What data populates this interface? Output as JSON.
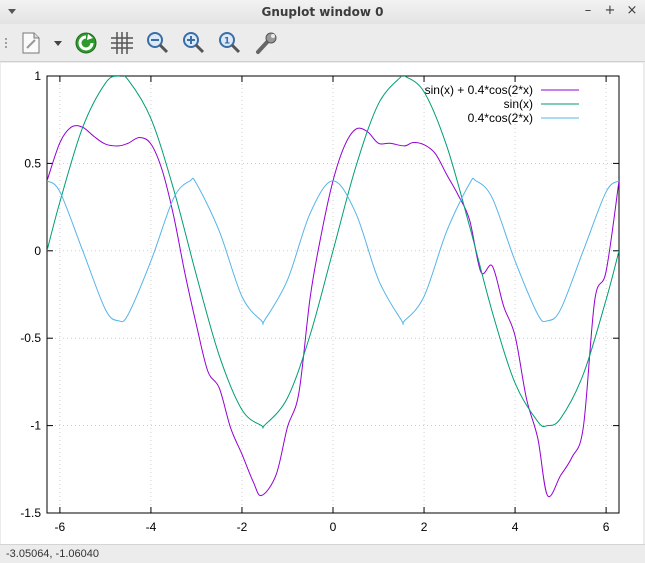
{
  "window": {
    "title": "Gnuplot window 0",
    "controls": [
      "–",
      "+",
      "×"
    ]
  },
  "toolbar": {
    "items": [
      {
        "name": "export-icon",
        "tooltip": ""
      },
      {
        "name": "replot-icon",
        "tooltip": ""
      },
      {
        "name": "grid-icon",
        "tooltip": ""
      },
      {
        "name": "zoom-out-icon",
        "tooltip": ""
      },
      {
        "name": "zoom-in-icon",
        "tooltip": ""
      },
      {
        "name": "zoom-reset-icon",
        "tooltip": ""
      },
      {
        "name": "settings-wrench-icon",
        "tooltip": ""
      }
    ]
  },
  "status": {
    "coords": "-3.05064, -1.06040"
  },
  "chart_data": {
    "type": "line",
    "title": "",
    "xlabel": "",
    "ylabel": "",
    "xlim": [
      -6.2832,
      6.2832
    ],
    "ylim": [
      -1.5,
      1
    ],
    "xticks": [
      -6,
      -4,
      -2,
      0,
      2,
      4,
      6
    ],
    "xtick_labels": [
      "-6",
      "-4",
      "-2",
      "0",
      "2",
      "4",
      "6"
    ],
    "yticks": [
      -1.5,
      -1,
      -0.5,
      0,
      0.5,
      1
    ],
    "ytick_labels": [
      "-1.5",
      "-1",
      "-0.5",
      "0",
      "0.5",
      "1"
    ],
    "grid": true,
    "legend_position": "top-right",
    "series": [
      {
        "name": "sin(x) + 0.4*cos(2*x)",
        "color": "#9400d3",
        "x": [
          -6.2832,
          -6,
          -5.75,
          -5.5,
          -5.25,
          -5,
          -4.7124,
          -4.5,
          -4.25,
          -4,
          -3.75,
          -3.5,
          -3.25,
          -3,
          -2.75,
          -2.5,
          -2.25,
          -2,
          -1.75,
          -1.5708,
          -1.25,
          -1,
          -0.75,
          -0.5,
          -0.25,
          0,
          0.25,
          0.5,
          0.75,
          1,
          1.25,
          1.5708,
          1.75,
          2,
          2.25,
          2.5,
          2.75,
          3,
          3.25,
          3.5,
          3.75,
          4,
          4.25,
          4.5,
          4.7124,
          5,
          5.25,
          5.5,
          5.75,
          6,
          6.2832
        ],
        "y": [
          0.4,
          0.6186,
          0.7077,
          0.7068,
          0.6539,
          0.6107,
          0.6,
          0.6153,
          0.6481,
          0.6109,
          0.4588,
          0.1986,
          -0.1328,
          -0.4251,
          -0.6891,
          -0.7838,
          -1.0125,
          -1.1638,
          -1.3231,
          -1.4,
          -1.2814,
          -1.008,
          -0.8135,
          -0.2633,
          0.1037,
          0.4,
          0.5983,
          0.6956,
          0.6827,
          0.615,
          0.6151,
          0.6,
          0.6191,
          0.6068,
          0.5551,
          0.435,
          0.3186,
          0.1769,
          -0.1213,
          -0.0875,
          -0.3178,
          -0.4868,
          -0.8453,
          -1.0739,
          -1.4,
          -1.2855,
          -1.1812,
          -1.0081,
          -0.2829,
          -0.1169,
          0.4
        ]
      },
      {
        "name": "sin(x)",
        "color": "#009e73",
        "x": [
          -6.2832,
          -6,
          -5.5,
          -5,
          -4.7124,
          -4.5,
          -4,
          -3.5,
          -3,
          -2.5,
          -2,
          -1.5708,
          -1.5,
          -1,
          -0.5,
          0,
          0.5,
          1,
          1.5,
          1.5708,
          2,
          2.5,
          3,
          3.5,
          4,
          4.5,
          4.7124,
          5,
          5.5,
          6,
          6.2832
        ],
        "y": [
          0,
          0.2794,
          0.7055,
          0.9589,
          1,
          0.9775,
          0.7568,
          0.3508,
          -0.1411,
          -0.5985,
          -0.9093,
          -1,
          -0.9975,
          -0.8415,
          -0.4794,
          0,
          0.4794,
          0.8415,
          0.9975,
          1,
          0.9093,
          0.5985,
          0.1411,
          -0.3508,
          -0.7568,
          -0.9775,
          -1,
          -0.9589,
          -0.7055,
          -0.2794,
          0
        ]
      },
      {
        "name": "0.4*cos(2*x)",
        "color": "#56b4e9",
        "x": [
          -6.2832,
          -6,
          -5.5,
          -5,
          -4.7124,
          -4.5,
          -4,
          -3.5,
          -3.1416,
          -3,
          -2.5,
          -2,
          -1.5708,
          -1.5,
          -1,
          -0.5,
          0,
          0.5,
          1,
          1.5,
          1.5708,
          2,
          2.5,
          3,
          3.1416,
          3.5,
          4,
          4.5,
          4.7124,
          5,
          5.5,
          6,
          6.2832
        ],
        "y": [
          0.4,
          0.3375,
          0.0018,
          -0.3356,
          -0.4,
          -0.3644,
          -0.0582,
          0.3016,
          0.4,
          0.3841,
          0.1134,
          -0.2615,
          -0.4,
          -0.396,
          -0.1665,
          0.2161,
          0.4,
          0.2161,
          -0.1665,
          -0.396,
          -0.4,
          -0.2615,
          0.1134,
          0.3841,
          0.4,
          0.3016,
          -0.0582,
          -0.3644,
          -0.4,
          -0.3356,
          0.0018,
          0.3375,
          0.4
        ]
      }
    ]
  }
}
